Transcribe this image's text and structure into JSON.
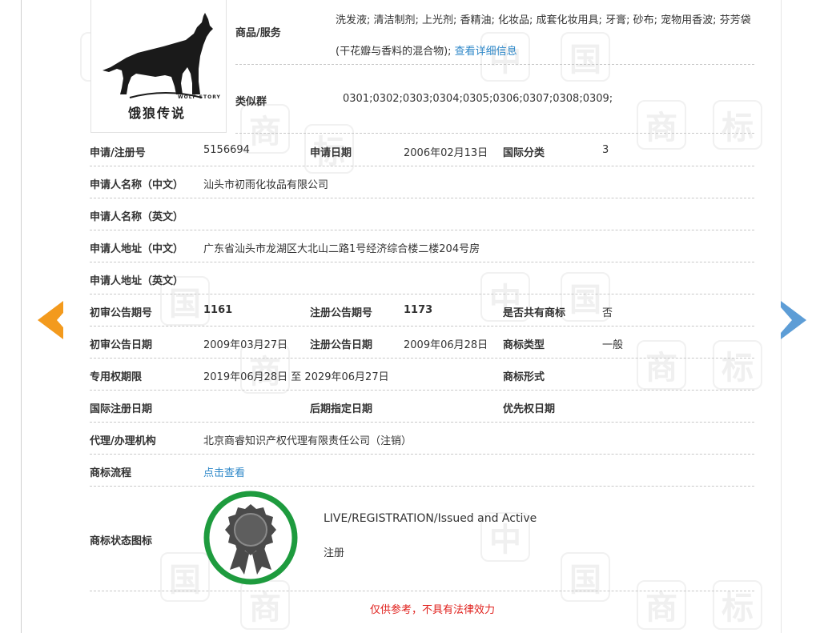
{
  "watermark": {
    "char1": "中",
    "char2": "国",
    "char3": "商",
    "char4": "标"
  },
  "logo": {
    "brand_cn": "饿狼传说",
    "brand_en": "WOLF STORY"
  },
  "goods": {
    "label": "商品/服务",
    "text": "洗发液; 清洁制剂; 上光剂; 香精油; 化妆品; 成套化妆用具; 牙膏; 砂布; 宠物用香波; 芬芳袋(干花瓣与香料的混合物); ",
    "detail_link": "查看详细信息"
  },
  "similar_group": {
    "label": "类似群",
    "value": "0301;0302;0303;0304;0305;0306;0307;0308;0309;"
  },
  "fields": {
    "reg_no_label": "申请/注册号",
    "reg_no": "5156694",
    "app_date_label": "申请日期",
    "app_date": "2006年02月13日",
    "intl_class_label": "国际分类",
    "intl_class": "3",
    "applicant_cn_label": "申请人名称（中文）",
    "applicant_cn": "汕头市初雨化妆品有限公司",
    "applicant_en_label": "申请人名称（英文）",
    "applicant_en": "",
    "address_cn_label": "申请人地址（中文）",
    "address_cn": "广东省汕头市龙湖区大北山二路1号经济综合楼二楼204号房",
    "address_en_label": "申请人地址（英文）",
    "address_en": "",
    "prelim_issue_label": "初审公告期号",
    "prelim_issue": "1161",
    "reg_issue_label": "注册公告期号",
    "reg_issue": "1173",
    "shared_label": "是否共有商标",
    "shared": "否",
    "prelim_date_label": "初审公告日期",
    "prelim_date": "2009年03月27日",
    "reg_date_label": "注册公告日期",
    "reg_date": "2009年06月28日",
    "tm_type_label": "商标类型",
    "tm_type": "一般",
    "exclusive_label": "专用权期限",
    "exclusive": "2019年06月28日 至 2029年06月27日",
    "tm_form_label": "商标形式",
    "tm_form": "",
    "intl_reg_date_label": "国际注册日期",
    "intl_reg_date": "",
    "later_date_label": "后期指定日期",
    "later_date": "",
    "priority_label": "优先权日期",
    "priority": "",
    "agent_label": "代理/办理机构",
    "agent": "北京商睿知识产权代理有限责任公司（注销）",
    "flow_label": "商标流程",
    "flow_link": "点击查看",
    "status_label": "商标状态图标",
    "status_en": "LIVE/REGISTRATION/Issued and Active",
    "status_cn": "注册"
  },
  "disclaimer": "仅供参考，不具有法律效力",
  "colors": {
    "link": "#2d87c8",
    "arrow_prev": "#f39a1d",
    "arrow_next": "#5d9dd6",
    "status_ring": "#1e9b3e",
    "disclaimer": "#e0201c"
  }
}
